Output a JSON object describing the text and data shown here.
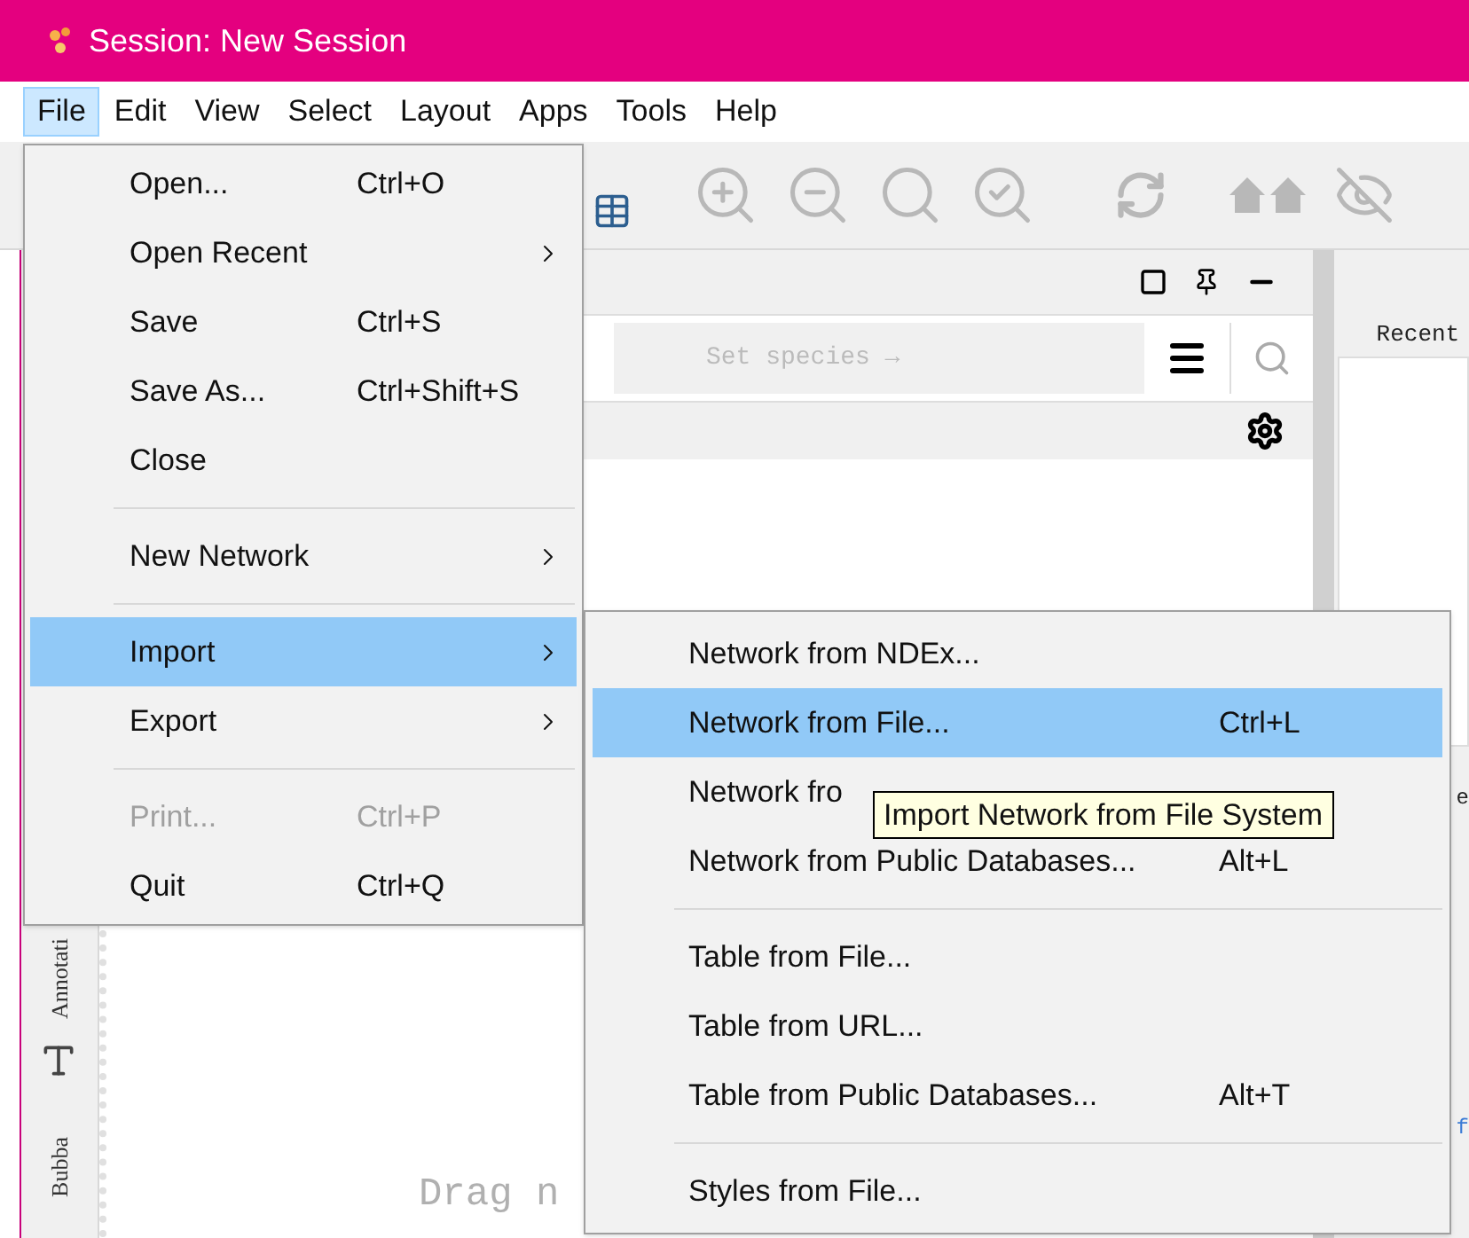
{
  "window": {
    "title": "Session: New Session"
  },
  "menubar": [
    {
      "label": "File",
      "selected": true
    },
    {
      "label": "Edit",
      "selected": false
    },
    {
      "label": "View",
      "selected": false
    },
    {
      "label": "Select",
      "selected": false
    },
    {
      "label": "Layout",
      "selected": false
    },
    {
      "label": "Apps",
      "selected": false
    },
    {
      "label": "Tools",
      "selected": false
    },
    {
      "label": "Help",
      "selected": false
    }
  ],
  "file_menu": [
    {
      "kind": "item",
      "label": "Open...",
      "shortcut": "Ctrl+O",
      "submenu": false,
      "selected": false,
      "disabled": false
    },
    {
      "kind": "item",
      "label": "Open Recent",
      "submenu": true,
      "selected": false,
      "disabled": false
    },
    {
      "kind": "item",
      "label": "Save",
      "shortcut": "Ctrl+S",
      "submenu": false,
      "selected": false,
      "disabled": false
    },
    {
      "kind": "item",
      "label": "Save As...",
      "shortcut": "Ctrl+Shift+S",
      "submenu": false,
      "selected": false,
      "disabled": false
    },
    {
      "kind": "item",
      "label": "Close",
      "submenu": false,
      "selected": false,
      "disabled": false
    },
    {
      "kind": "separator"
    },
    {
      "kind": "item",
      "label": "New Network",
      "submenu": true,
      "selected": false,
      "disabled": false
    },
    {
      "kind": "separator"
    },
    {
      "kind": "item",
      "label": "Import",
      "submenu": true,
      "selected": true,
      "disabled": false
    },
    {
      "kind": "item",
      "label": "Export",
      "submenu": true,
      "selected": false,
      "disabled": false
    },
    {
      "kind": "separator"
    },
    {
      "kind": "item",
      "label": "Print...",
      "shortcut": "Ctrl+P",
      "submenu": false,
      "selected": false,
      "disabled": true
    },
    {
      "kind": "item",
      "label": "Quit",
      "shortcut": "Ctrl+Q",
      "submenu": false,
      "selected": false,
      "disabled": false
    }
  ],
  "import_menu": [
    {
      "kind": "item",
      "label": "Network from NDEx...",
      "selected": false
    },
    {
      "kind": "item",
      "label": "Network from File...",
      "shortcut": "Ctrl+L",
      "selected": true
    },
    {
      "kind": "item",
      "label": "Network fro",
      "selected": false
    },
    {
      "kind": "item",
      "label": "Network from Public Databases...",
      "shortcut": "Alt+L",
      "selected": false
    },
    {
      "kind": "separator"
    },
    {
      "kind": "item",
      "label": "Table from File...",
      "selected": false
    },
    {
      "kind": "item",
      "label": "Table from URL...",
      "selected": false
    },
    {
      "kind": "item",
      "label": "Table from Public Databases...",
      "shortcut": "Alt+T",
      "selected": false
    },
    {
      "kind": "separator"
    },
    {
      "kind": "item",
      "label": "Styles from File...",
      "selected": false
    }
  ],
  "tooltip": "Import Network from File System",
  "side_tabs": [
    "Annotati",
    "Bubba"
  ],
  "network_panel": {
    "search_placeholder": "Set species →",
    "canvas_hint": "Drag n"
  },
  "right_panel": {
    "label": "Recent",
    "fragments": [
      "e",
      "f"
    ]
  }
}
